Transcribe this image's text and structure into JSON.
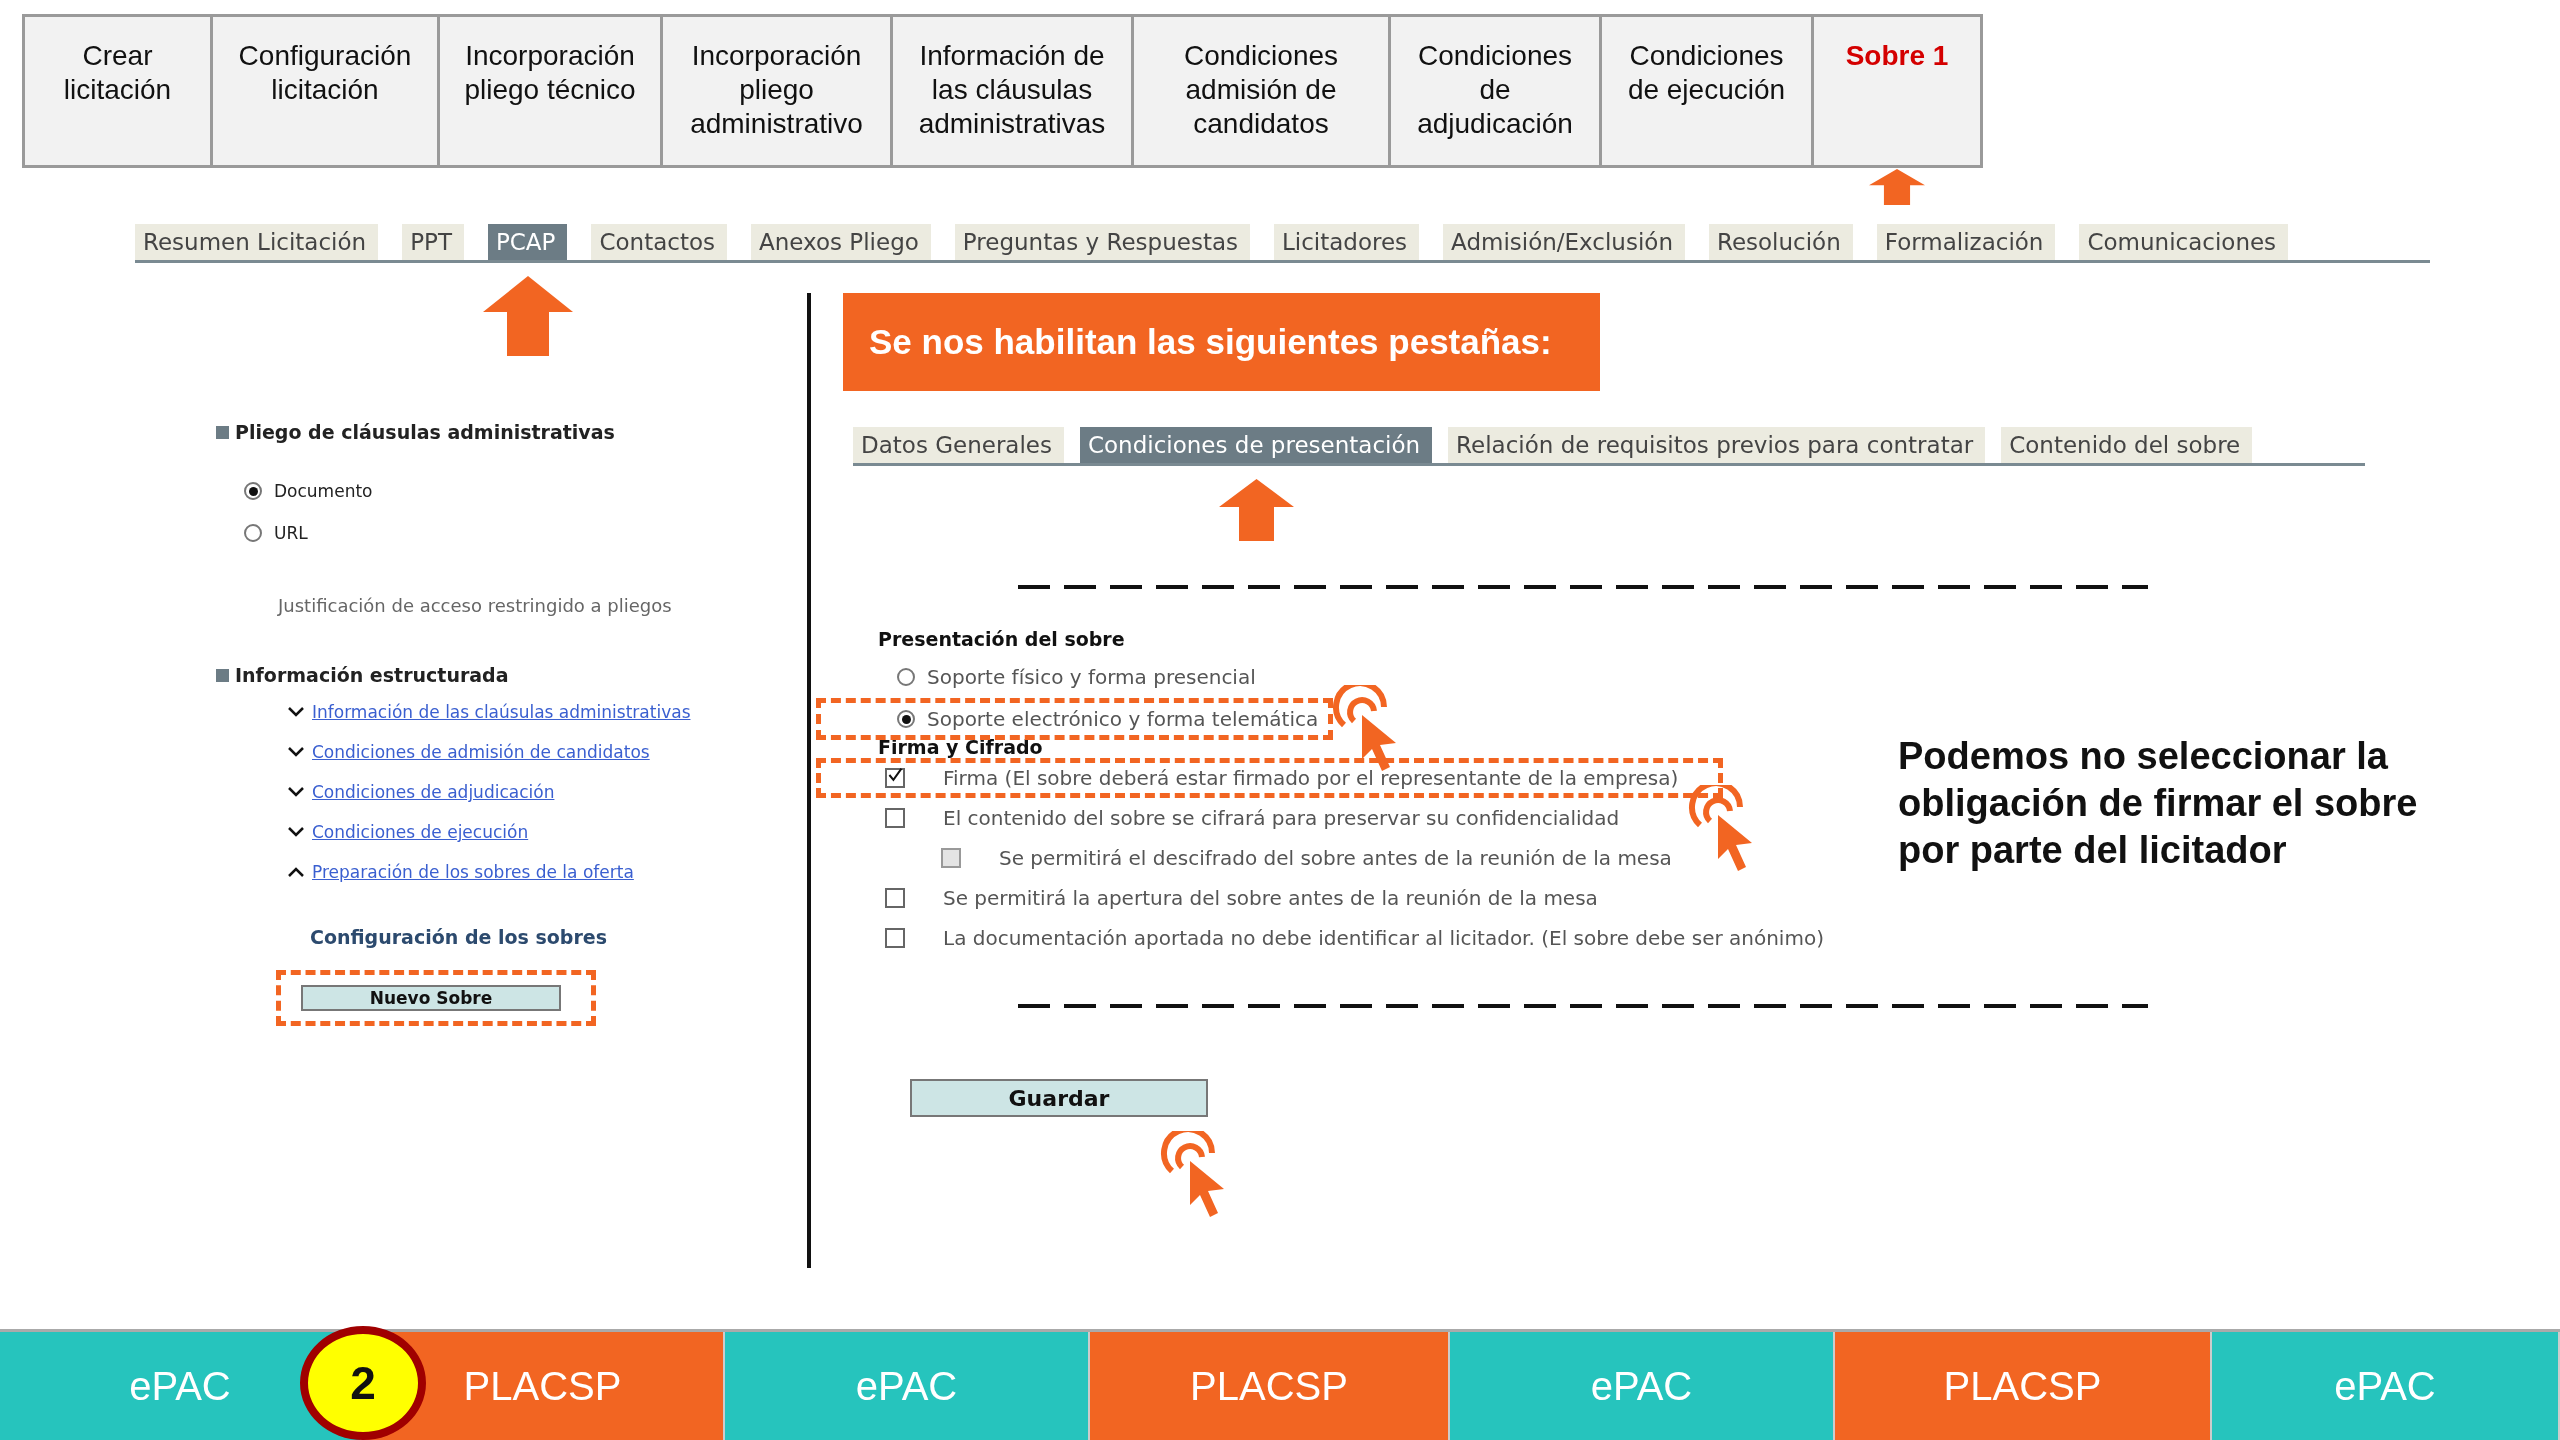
{
  "steps": [
    {
      "label": "Crear licitación",
      "selected": false,
      "arrow": false
    },
    {
      "label": "Configuración licitación",
      "selected": false,
      "arrow": false
    },
    {
      "label": "Incorporación pliego técnico",
      "selected": false,
      "arrow": false
    },
    {
      "label": "Incorporación pliego administrativo",
      "selected": false,
      "arrow": false
    },
    {
      "label": "Información de las cláusulas administrativas",
      "selected": false,
      "arrow": false
    },
    {
      "label": "Condiciones admisión de candidatos",
      "selected": false,
      "arrow": false
    },
    {
      "label": "Condiciones de adjudicación",
      "selected": false,
      "arrow": false
    },
    {
      "label": "Condiciones de ejecución",
      "selected": false,
      "arrow": false
    },
    {
      "label": "Sobre 1",
      "selected": true,
      "arrow": true
    }
  ],
  "tabs": [
    {
      "label": "Resumen Licitación",
      "selected": false,
      "arrow": false
    },
    {
      "label": "PPT",
      "selected": false,
      "arrow": false
    },
    {
      "label": "PCAP",
      "selected": true,
      "arrow": true
    },
    {
      "label": "Contactos",
      "selected": false,
      "arrow": false
    },
    {
      "label": "Anexos Pliego",
      "selected": false,
      "arrow": false
    },
    {
      "label": "Preguntas y Respuestas",
      "selected": false,
      "arrow": false
    },
    {
      "label": "Licitadores",
      "selected": false,
      "arrow": false
    },
    {
      "label": "Admisión/Exclusión",
      "selected": false,
      "arrow": false
    },
    {
      "label": "Resolución",
      "selected": false,
      "arrow": false
    },
    {
      "label": "Formalización",
      "selected": false,
      "arrow": false
    },
    {
      "label": "Comunicaciones",
      "selected": false,
      "arrow": false
    }
  ],
  "sidebar": {
    "heading": "Pliego de cláusulas administrativas",
    "radios": [
      {
        "label": "Documento",
        "selected": true
      },
      {
        "label": "URL",
        "selected": false
      }
    ],
    "justification": "Justificación de acceso restringido a pliegos",
    "structured_heading": "Información estructurada",
    "links": [
      {
        "label": "Información de las claúsulas administrativas",
        "expanded": false
      },
      {
        "label": "Condiciones de admisión de candidatos",
        "expanded": false
      },
      {
        "label": "Condiciones de adjudicación",
        "expanded": false
      },
      {
        "label": "Condiciones de ejecución",
        "expanded": false
      },
      {
        "label": "Preparación de los sobres de la oferta",
        "expanded": true
      }
    ],
    "config_heading": "Configuración de los sobres",
    "new_button": {
      "label": "Nuevo Sobre",
      "highlighted": true
    }
  },
  "banner": "Se nos habilitan las siguientes pestañas:",
  "subtabs": [
    {
      "label": "Datos Generales",
      "selected": false,
      "arrow": false
    },
    {
      "label": "Condiciones de presentación",
      "selected": true,
      "arrow": true
    },
    {
      "label": "Relación de requisitos previos para contratar",
      "selected": false,
      "arrow": false
    },
    {
      "label": "Contenido del sobre",
      "selected": false,
      "arrow": false
    }
  ],
  "form": {
    "presentation_heading": "Presentación del sobre",
    "presentation_options": [
      {
        "label": "Soporte físico y forma presencial",
        "selected": false,
        "highlighted": false,
        "pointer": false
      },
      {
        "label": "Soporte electrónico y forma telemática",
        "selected": true,
        "highlighted": true,
        "pointer": true
      }
    ],
    "signing_heading": "Firma y Cifrado",
    "signing_options": [
      {
        "label": "Firma (El sobre deberá estar firmado por el representante de la empresa)",
        "checked": true,
        "disabled": false,
        "highlighted": true,
        "pointer": true
      },
      {
        "label": "El contenido del sobre se cifrará para preservar su confidencialidad",
        "checked": false,
        "disabled": false,
        "highlighted": false,
        "pointer": false,
        "children": [
          {
            "label": "Se permitirá el descifrado del sobre antes de la reunión de la mesa",
            "checked": false,
            "disabled": true,
            "highlighted": false,
            "pointer": false
          }
        ]
      },
      {
        "label": "Se permitirá la apertura del sobre antes de la reunión de la mesa",
        "checked": false,
        "disabled": false,
        "highlighted": false,
        "pointer": false
      },
      {
        "label": "La documentación aportada no debe identificar al licitador. (El sobre debe ser anónimo)",
        "checked": false,
        "disabled": false,
        "highlighted": false,
        "pointer": false
      }
    ],
    "save_button": {
      "label": "Guardar",
      "pointer": true
    }
  },
  "annotation": "Podemos no seleccionar la obligación de firmar el sobre por parte del licitador",
  "footer": [
    {
      "label": "ePAC",
      "kind": "epac"
    },
    {
      "label": "PLACSP",
      "kind": "placsp"
    },
    {
      "label": "ePAC",
      "kind": "epac"
    },
    {
      "label": "PLACSP",
      "kind": "placsp"
    },
    {
      "label": "ePAC",
      "kind": "epac"
    },
    {
      "label": "PLACSP",
      "kind": "placsp"
    },
    {
      "label": "ePAC",
      "kind": "epac"
    }
  ],
  "step_badge": "2"
}
